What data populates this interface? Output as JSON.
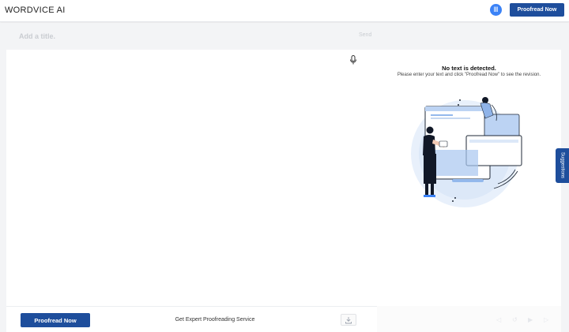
{
  "header": {
    "logo": "WORDVICE AI",
    "avatar_letter": "Ⅲ",
    "proofread_label": "Proofread Now"
  },
  "editor": {
    "title_placeholder": "Add a title.",
    "send_label": "Send",
    "mic_icon": "microphone-icon"
  },
  "result": {
    "empty_title": "No text is detected.",
    "empty_subtitle": "Please enter your text and click \"Proofread Now\" to see the revision."
  },
  "sidebar_tab": {
    "label": "Suggestions"
  },
  "footer": {
    "proofread_label": "Proofread Now",
    "expert_link": "Get Expert Proofreading Service",
    "download_icon": "download-icon"
  },
  "colors": {
    "brand": "#1e4e9c",
    "avatar": "#3b82f6"
  }
}
